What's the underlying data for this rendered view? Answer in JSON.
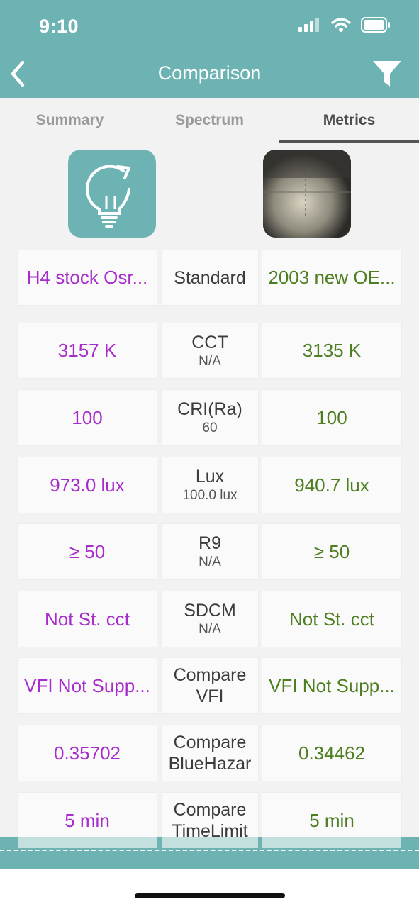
{
  "status": {
    "time": "9:10"
  },
  "nav": {
    "title": "Comparison"
  },
  "tabs": [
    {
      "label": "Summary"
    },
    {
      "label": "Spectrum"
    },
    {
      "label": "Metrics"
    }
  ],
  "active_tab": "Metrics",
  "items": {
    "left_name": "H4 stock Osr...",
    "middle_name": "Standard",
    "right_name": "2003 new OE..."
  },
  "rows": [
    {
      "left": "3157 K",
      "metric": "CCT",
      "standard": "N/A",
      "right": "3135 K"
    },
    {
      "left": "100",
      "metric": "CRI(Ra)",
      "standard": "60",
      "right": "100"
    },
    {
      "left": "973.0 lux",
      "metric": "Lux",
      "standard": "100.0 lux",
      "right": "940.7 lux"
    },
    {
      "left": "≥ 50",
      "metric": "R9",
      "standard": "N/A",
      "right": "≥ 50"
    },
    {
      "left": "Not St. cct",
      "metric": "SDCM",
      "standard": "N/A",
      "right": "Not St. cct"
    },
    {
      "left": "VFI Not Supp...",
      "metric": "Compare",
      "metric2": "VFI",
      "right": "VFI Not Supp..."
    },
    {
      "left": "0.35702",
      "metric": "Compare",
      "metric2": "BlueHazar",
      "right": "0.34462"
    },
    {
      "left": "5 min",
      "metric": "Compare",
      "metric2": "TimeLimit",
      "right": "5 min"
    }
  ],
  "colors": {
    "accent": "#6db3b4",
    "left_value": "#a82bcc",
    "right_value": "#4e7e22"
  },
  "icons": {
    "back": "chevron-left-icon",
    "filter": "filter-funnel-icon",
    "bulb": "lightbulb-refresh-icon"
  }
}
